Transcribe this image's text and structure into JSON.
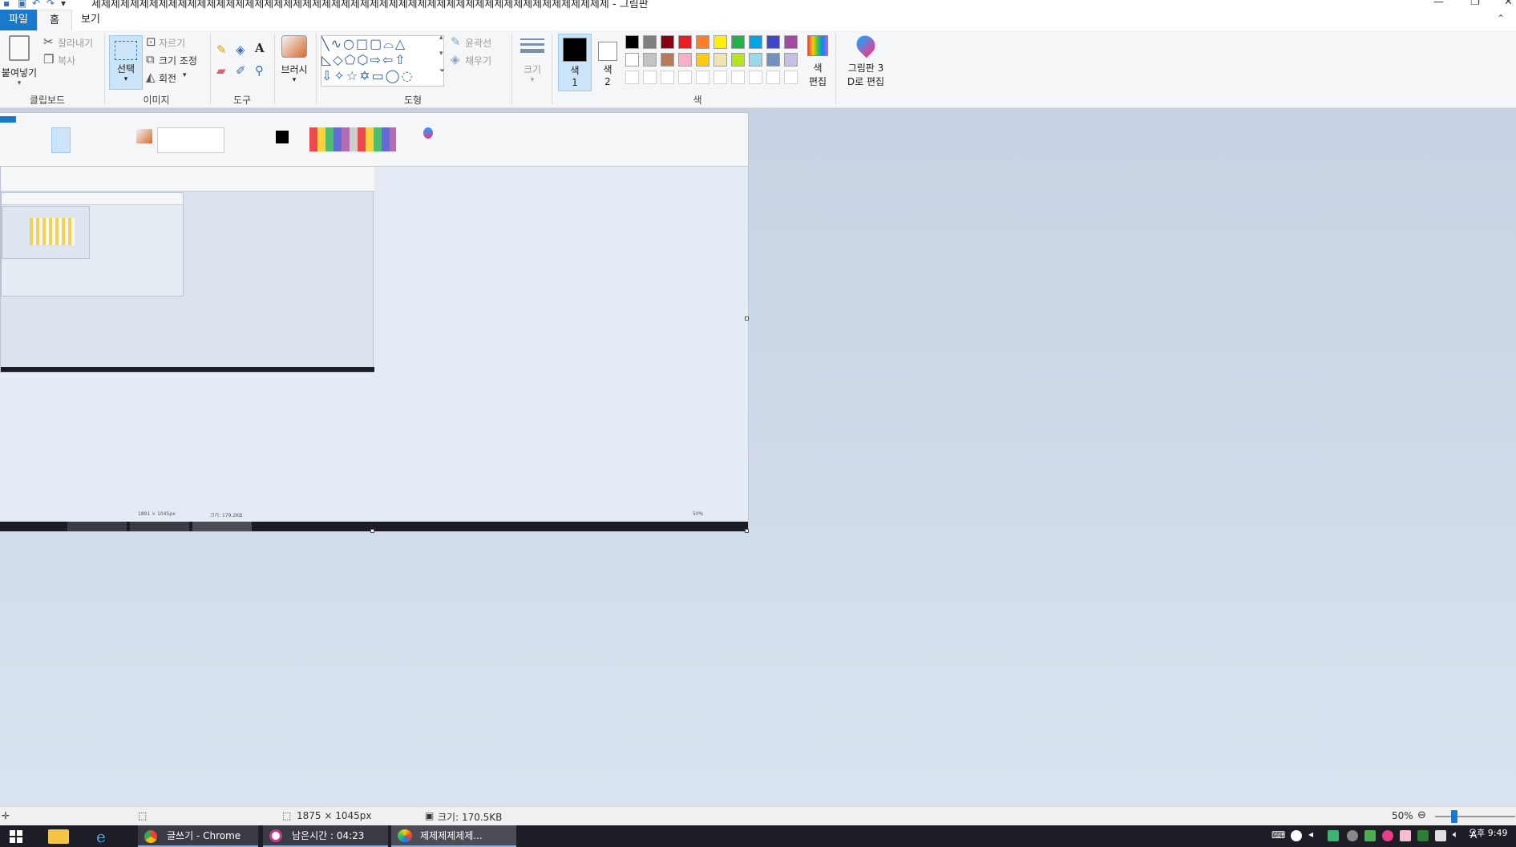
{
  "window": {
    "title": "세제제제제제제제제제제제제제제제제제제제제제제제제제제제제제제제제제제제제제제제제제제제제제제제제제제제제제 - 그림판",
    "controls": [
      "—",
      "❐",
      "✕"
    ]
  },
  "menu": {
    "file": "파일",
    "home": "홈",
    "view": "보기"
  },
  "ribbon": {
    "clipboard": {
      "paste": "붙여넣기",
      "cut": "잘라내기",
      "copy": "복사",
      "group": "클립보드"
    },
    "image": {
      "select": "선택",
      "crop": "자르기",
      "resize": "크기 조정",
      "rotate": "회전",
      "group": "이미지"
    },
    "tools": {
      "group": "도구"
    },
    "brush": {
      "label": "브러시"
    },
    "shapes": {
      "outline": "윤곽선",
      "fill": "채우기",
      "group": "도형"
    },
    "size": {
      "label": "크기"
    },
    "color1": {
      "line1": "색",
      "line2": "1"
    },
    "color2": {
      "line1": "색",
      "line2": "2"
    },
    "edit_colors": {
      "line1": "색",
      "line2": "편집"
    },
    "paint3d": {
      "line1": "그림판 3",
      "line2": "D로 편집"
    },
    "colors_group": "색",
    "palette_row1": [
      "#000000",
      "#7f7f7f",
      "#880015",
      "#ed1c24",
      "#ff7f27",
      "#fff200",
      "#22b14c",
      "#00a2e8",
      "#3f48cc",
      "#a349a4"
    ],
    "palette_row2": [
      "#ffffff",
      "#c3c3c3",
      "#b97a57",
      "#ffaec9",
      "#ffc90e",
      "#efe4b0",
      "#b5e61d",
      "#99d9ea",
      "#7092be",
      "#c8bfe7"
    ]
  },
  "canvas": {
    "inner_status": {
      "dimensions": "1891 × 1045px",
      "size": "크기: 179.2KB",
      "zoom": "50%"
    }
  },
  "status": {
    "dimensions": "1875 × 1045px",
    "filesize": "크기: 170.5KB",
    "zoom": "50%"
  },
  "taskbar": {
    "chrome": "글쓰기 - Chrome",
    "timer": "남은시간 : 04:23",
    "paint": "제제제제제제...",
    "clock": "오후 9:49",
    "ime": "A"
  }
}
